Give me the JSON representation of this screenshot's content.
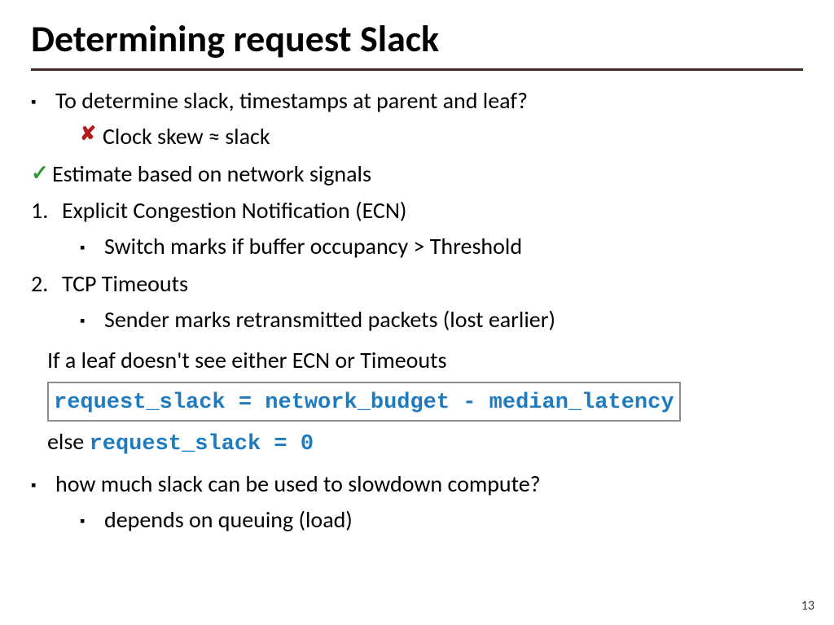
{
  "title": "Determining request Slack",
  "bullets": {
    "b1": "To determine slack, timestamps at parent and leaf?",
    "b1_sub": "Clock skew ≈ slack",
    "b2": "Estimate based on network signals",
    "n1_num": "1.",
    "n1": "Explicit Congestion Notification (ECN)",
    "n1_sub": "Switch marks if buffer occupancy > Threshold",
    "n2_num": "2.",
    "n2": "TCP Timeouts",
    "n2_sub": "Sender marks retransmitted packets (lost earlier)",
    "cond_if": "If a leaf doesn't see either ECN or Timeouts",
    "formula1": "request_slack = network_budget - median_latency",
    "cond_else": "else ",
    "formula2": "request_slack = 0",
    "b3": "how much slack can be used to slowdown compute?",
    "b3_sub": "depends on queuing (load)"
  },
  "page_number": "13"
}
